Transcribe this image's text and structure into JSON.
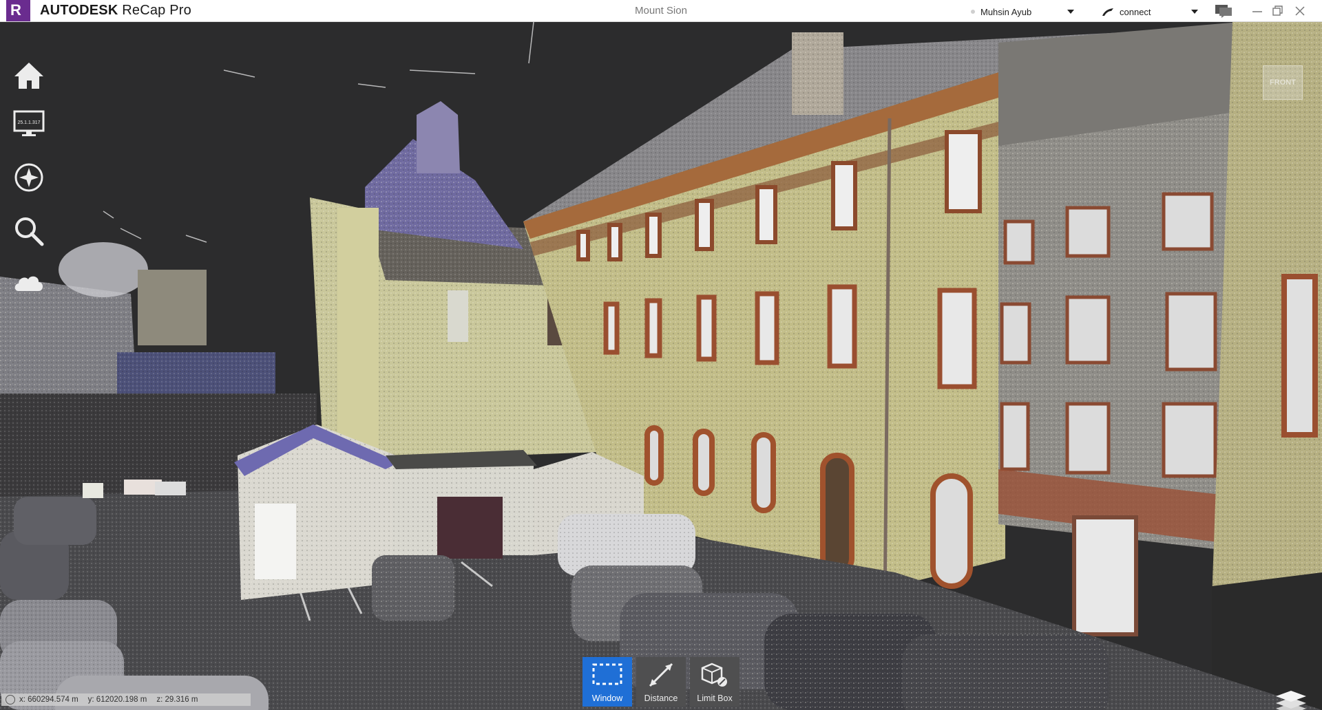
{
  "titlebar": {
    "logo_letter": "R",
    "brand": "AUTODESK",
    "product": "ReCap Pro",
    "document_title": "Mount Sion",
    "user_name": "Muhsin Ayub",
    "connect_label": "connect"
  },
  "leftnav": {
    "items": [
      {
        "name": "home-icon"
      },
      {
        "name": "monitor-icon",
        "version_text": "25.1.1.317"
      },
      {
        "name": "orbit-icon"
      },
      {
        "name": "search-icon"
      },
      {
        "name": "cloud-icon"
      }
    ]
  },
  "viewcube": {
    "face_label": "FRONT"
  },
  "toolbar": {
    "tools": [
      {
        "label": "Window",
        "icon": "window-select-icon",
        "active": true
      },
      {
        "label": "Distance",
        "icon": "distance-icon",
        "active": false
      },
      {
        "label": "Limit Box",
        "icon": "limit-box-icon",
        "active": false
      }
    ]
  },
  "coordinates": {
    "x": "x:  660294.574 m",
    "y": "y:  612020.198 m",
    "z": "z:  29.316 m"
  },
  "colors": {
    "accent": "#1f6fd6",
    "logo": "#6a2c8f",
    "viewport_bg": "#2c2c2d"
  }
}
